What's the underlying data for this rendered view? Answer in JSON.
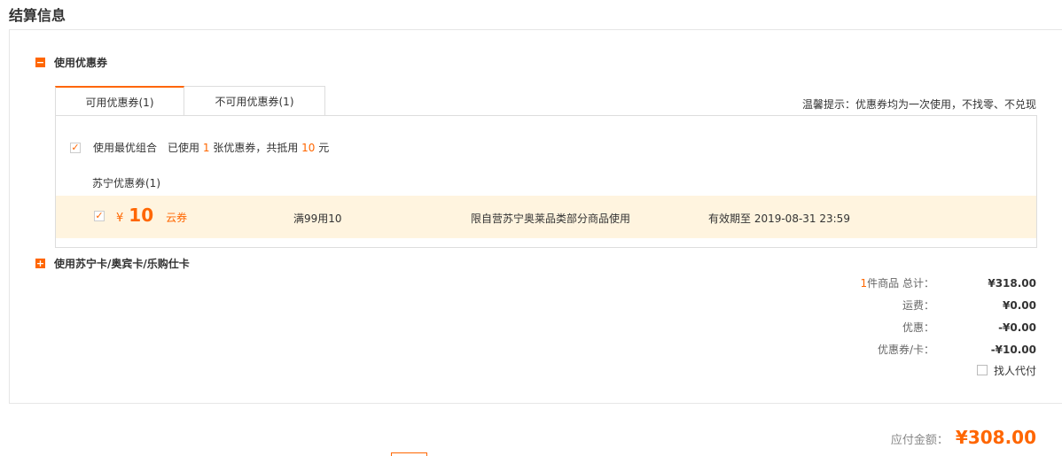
{
  "title": "结算信息",
  "coupon_section": {
    "header": "使用优惠券",
    "toggle_icon": "minus-icon",
    "tabs": [
      {
        "label": "可用优惠券(1)",
        "active": true
      },
      {
        "label": "不可用优惠券(1)",
        "active": false
      }
    ],
    "tip": "温馨提示：优惠券均为一次使用，不找零、不兑现",
    "best_combo": {
      "checked": true,
      "label": "使用最优组合",
      "used_prefix": "已使用",
      "used_count": "1",
      "used_mid": "张优惠券，共抵用",
      "used_amount": "10",
      "used_suffix": "元"
    },
    "group_label": "苏宁优惠券(1)",
    "coupons": [
      {
        "checked": true,
        "currency": "¥",
        "amount": "10",
        "type": "云券",
        "condition": "满99用10",
        "scope": "限自营苏宁奥莱品类部分商品使用",
        "expiry": "有效期至 2019-08-31 23:59"
      }
    ]
  },
  "card_section": {
    "header": "使用苏宁卡/奥宾卡/乐购仕卡",
    "toggle_icon": "plus-icon"
  },
  "summary": {
    "item_count": "1",
    "item_label": "件商品  总计：",
    "total": "¥318.00",
    "shipping_label": "运费：",
    "shipping": "¥0.00",
    "discount_label": "优惠：",
    "discount": "-¥0.00",
    "coupon_label": "优惠券/卡：",
    "coupon": "-¥10.00",
    "helper_pay_label": "找人代付",
    "payable_label": "应付金额：",
    "payable": "¥308.00"
  },
  "colors": {
    "accent": "#ff6600",
    "coupon_row_bg": "#fff4df"
  }
}
